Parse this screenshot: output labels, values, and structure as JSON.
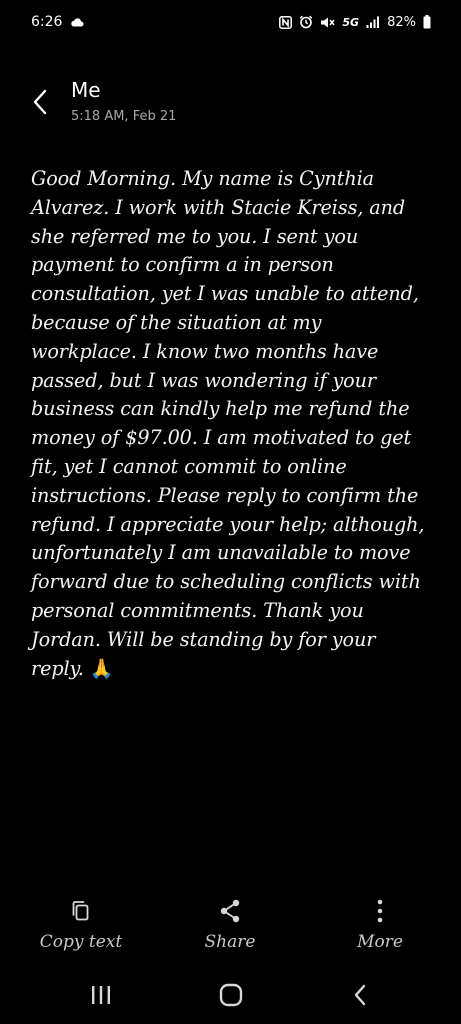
{
  "status_bar": {
    "time": "6:26",
    "network": "5G",
    "battery": "82%",
    "icons": [
      "cloud-icon",
      "nfc-icon",
      "alarm-icon",
      "mute-icon",
      "signal-icon",
      "battery-icon"
    ]
  },
  "header": {
    "title": "Me",
    "timestamp": "5:18 AM, Feb 21"
  },
  "message": {
    "text": "Good Morning.  My name is Cynthia Alvarez. I work with Stacie Kreiss, and she referred me to you. I sent you payment to confirm a in person consultation, yet I was unable to attend, because of the situation at my workplace. I know two months have passed, but I was wondering if your business can kindly help me refund the money of $97.00. I am motivated to get fit, yet I cannot commit to online instructions. Please reply to confirm the refund. I appreciate your help; although,  unfortunately I am unavailable to move forward  due to scheduling conflicts with personal commitments. Thank you Jordan. Will be standing by for your reply. ",
    "emoji": "🙏"
  },
  "actions": {
    "copy_label": "Copy text",
    "share_label": "Share",
    "more_label": "More"
  },
  "colors": {
    "background": "#000000",
    "text": "#f2f2f2",
    "secondary_text": "#a8a8a8",
    "action_label": "#c9c9c9"
  }
}
